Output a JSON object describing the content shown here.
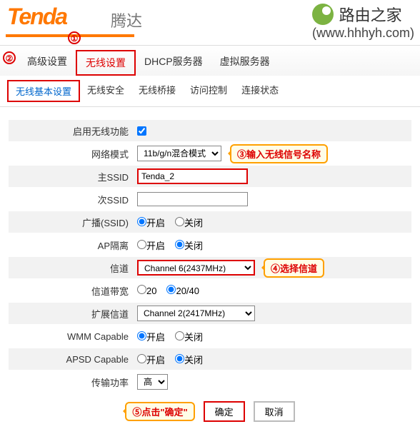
{
  "logo": {
    "brand_en": "Tenda",
    "brand_cn": "腾达"
  },
  "site": {
    "name": "路由之家",
    "url": "(www.hhhyh.com)"
  },
  "badges": {
    "b1": "①",
    "b2": "②",
    "b3": "③输入无线信号名称",
    "b4": "④选择信道",
    "b5": "⑤点击\"确定\""
  },
  "main_tabs": [
    "高级设置",
    "无线设置",
    "DHCP服务器",
    "虚拟服务器"
  ],
  "sub_tabs": [
    "无线基本设置",
    "无线安全",
    "无线桥接",
    "访问控制",
    "连接状态"
  ],
  "form": {
    "enable_label": "启用无线功能",
    "mode_label": "网络模式",
    "mode_value": "11b/g/n混合模式",
    "ssid_label": "主SSID",
    "ssid_value": "Tenda_2",
    "ssid2_label": "次SSID",
    "ssid2_value": "",
    "broadcast_label": "广播(SSID)",
    "ap_iso_label": "AP隔离",
    "channel_label": "信道",
    "channel_value": "Channel 6(2437MHz)",
    "bw_label": "信道带宽",
    "bw_opts": [
      "20",
      "20/40"
    ],
    "ext_ch_label": "扩展信道",
    "ext_ch_value": "Channel 2(2417MHz)",
    "wmm_label": "WMM Capable",
    "apsd_label": "APSD Capable",
    "tx_label": "传输功率",
    "tx_value": "高",
    "on": "开启",
    "off": "关闭"
  },
  "buttons": {
    "ok": "确定",
    "cancel": "取消"
  }
}
